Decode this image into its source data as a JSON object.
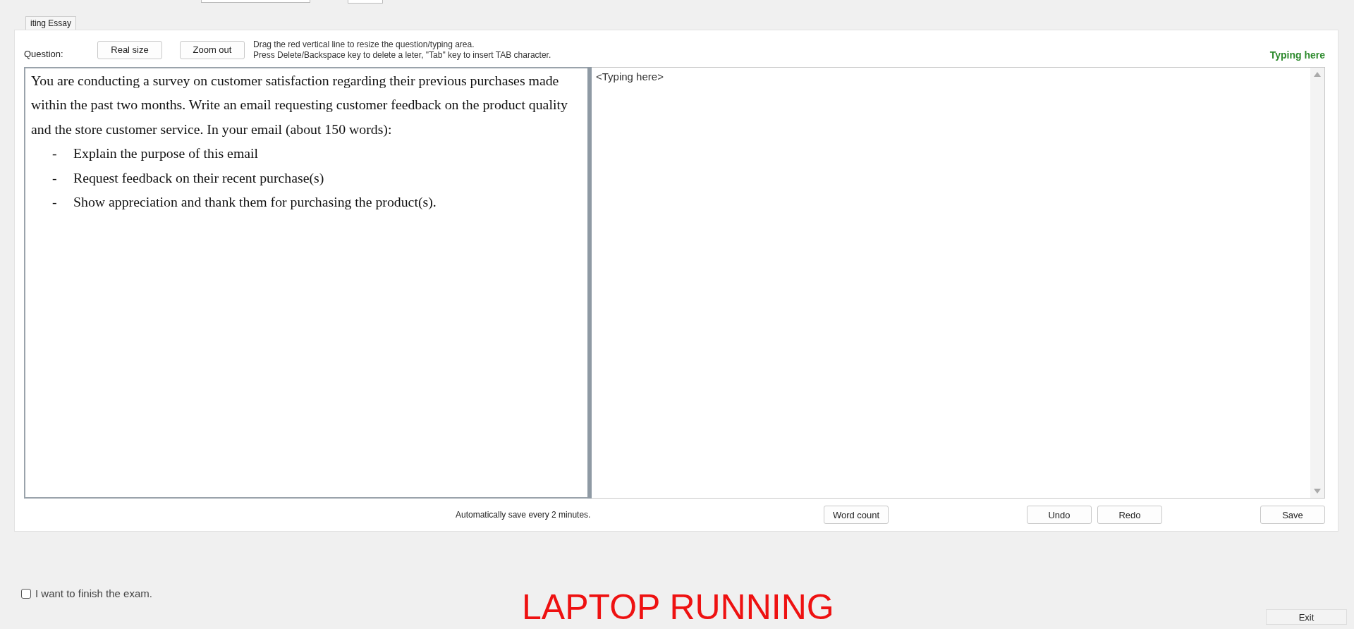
{
  "tab": {
    "label": "iting Essay"
  },
  "toolbar": {
    "question_label": "Question:",
    "buttons": [
      "Real size",
      "Zoom out"
    ],
    "hints": [
      "Drag the red vertical line to resize the question/typing area.",
      "Press Delete/Backspace key to delete a leter, \"Tab\" key to insert TAB character."
    ],
    "typing_label": "Typing here"
  },
  "question": {
    "paragraph": "You are conducting a survey on customer satisfaction regarding their previous purchases made within the past two months. Write an email requesting customer feedback on the product quality and the store customer service. In your email (about 150 words):",
    "bullets": [
      {
        "marker": "-",
        "text": "Explain the purpose of this email"
      },
      {
        "marker": "-",
        "text": "Request feedback on their recent purchase(s)"
      },
      {
        "marker": "-",
        "text": "Show appreciation and thank them for purchasing the product(s)."
      }
    ]
  },
  "editor": {
    "placeholder": "<Typing here>"
  },
  "footer": {
    "autosave": "Automatically save every 2 minutes.",
    "word_count": "Word count",
    "undo": "Undo",
    "redo": "Redo",
    "save": "Save"
  },
  "finish": {
    "label": "I want to finish the exam.",
    "checked": false
  },
  "status": "LAPTOP RUNNING",
  "exit": "Exit"
}
